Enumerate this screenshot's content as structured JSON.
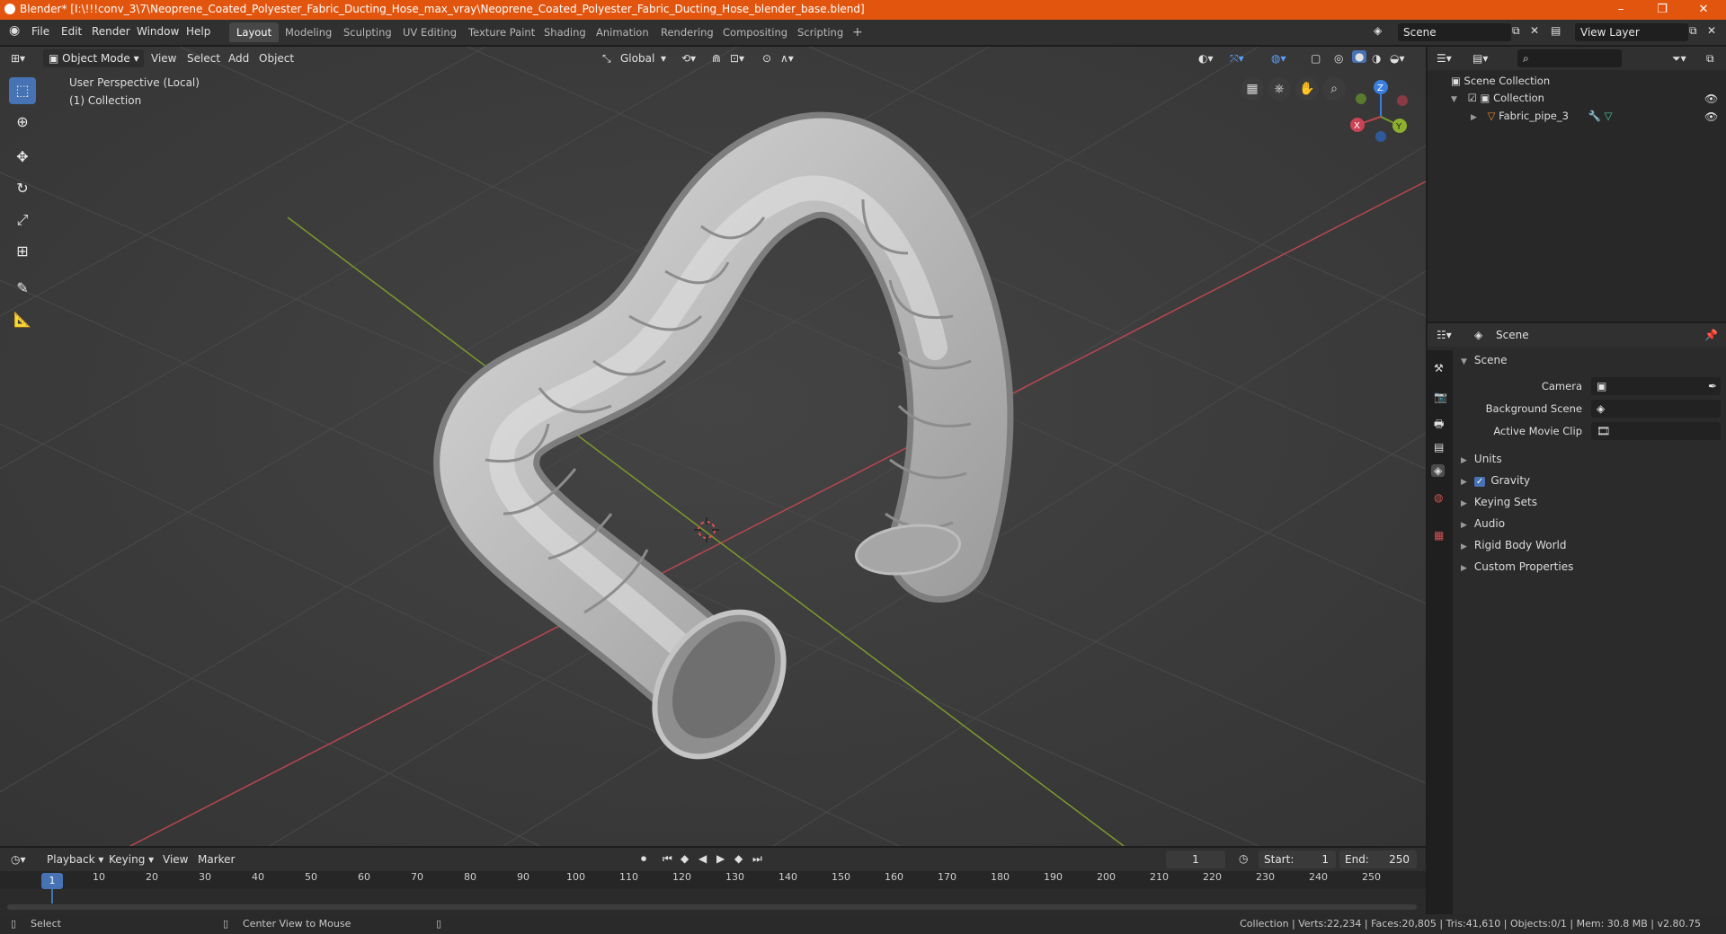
{
  "window": {
    "title": "Blender* [I:\\!!!conv_3\\7\\Neoprene_Coated_Polyester_Fabric_Ducting_Hose_max_vray\\Neoprene_Coated_Polyester_Fabric_Ducting_Hose_blender_base.blend]",
    "minimize": "–",
    "restore": "❐",
    "close": "✕"
  },
  "menu": [
    "File",
    "Edit",
    "Render",
    "Window",
    "Help"
  ],
  "workspaces": [
    "Layout",
    "Modeling",
    "Sculpting",
    "UV Editing",
    "Texture Paint",
    "Shading",
    "Animation",
    "Rendering",
    "Compositing",
    "Scripting"
  ],
  "workspace_add": "+",
  "scene_field": "Scene",
  "view_layer_field": "View Layer",
  "viewport_header": {
    "mode": "Object Mode",
    "view": "View",
    "select": "Select",
    "add": "Add",
    "object": "Object",
    "orientation": "Global"
  },
  "viewport_overlay": {
    "perspective": "User Perspective (Local)",
    "collection": "(1) Collection"
  },
  "gizmo": {
    "z": "Z",
    "y": "Y",
    "x": "X"
  },
  "outliner": {
    "root": "Scene Collection",
    "collection": "Collection",
    "object": "Fabric_pipe_3"
  },
  "properties": {
    "header": "Scene",
    "panel": "Scene",
    "camera_label": "Camera",
    "background_label": "Background Scene",
    "movie_clip_label": "Active Movie Clip",
    "sections": [
      "Units",
      "Gravity",
      "Keying Sets",
      "Audio",
      "Rigid Body World",
      "Custom Properties"
    ],
    "gravity_checked": true
  },
  "timeline": {
    "playback": "Playback",
    "keying": "Keying",
    "view": "View",
    "marker": "Marker",
    "current_frame": "1",
    "start_label": "Start:",
    "start": "1",
    "end_label": "End:",
    "end": "250",
    "ticks": [
      "1",
      "10",
      "20",
      "30",
      "40",
      "50",
      "60",
      "70",
      "80",
      "90",
      "100",
      "110",
      "120",
      "130",
      "140",
      "150",
      "160",
      "170",
      "180",
      "190",
      "200",
      "210",
      "220",
      "230",
      "240",
      "250"
    ]
  },
  "statusbar": {
    "select": "Select",
    "center_view": "Center View to Mouse",
    "stats": "Collection | Verts:22,234 | Faces:20,805 | Tris:41,610 | Objects:0/1 | Mem: 30.8 MB | v2.80.75"
  },
  "colors": {
    "titlebar": "#e2550f",
    "accent": "#4772b3",
    "x_axis": "#b8474f",
    "y_axis": "#7c9a2b",
    "z_axis": "#3a7ee0"
  }
}
